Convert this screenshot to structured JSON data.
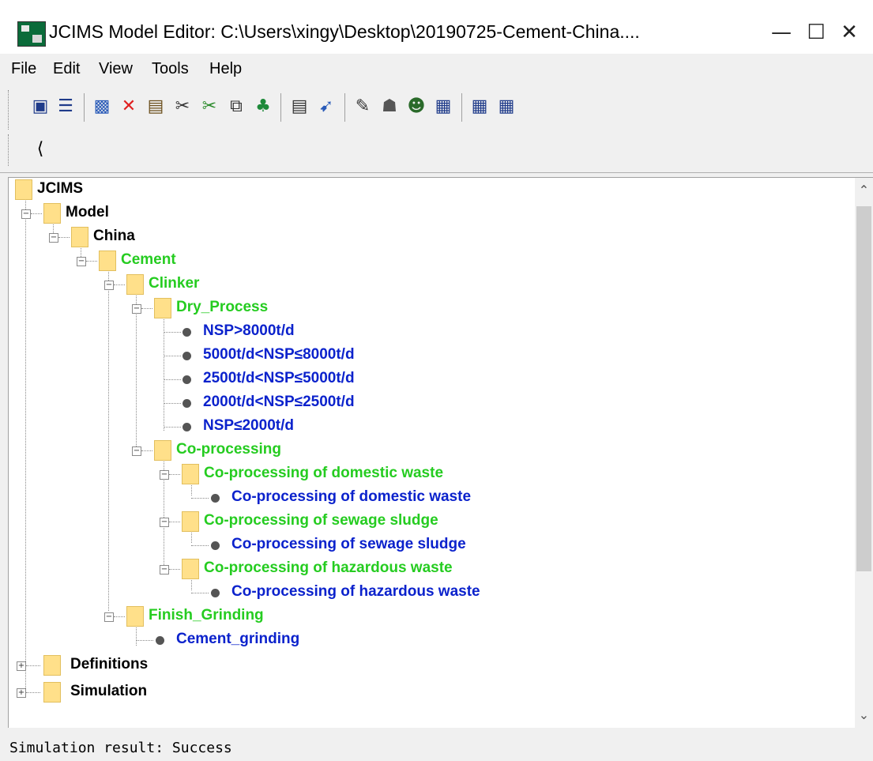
{
  "window": {
    "title": "JCIMS Model Editor:  C:\\Users\\xingy\\Desktop\\20190725-Cement-China....",
    "minimize": "—",
    "maximize": "☐",
    "close": "✕"
  },
  "menu": [
    "File",
    "Edit",
    "View",
    "Tools",
    "Help"
  ],
  "toolbar": {
    "icons": [
      "save-icon",
      "list-icon",
      "new-object-icon",
      "delete-icon",
      "paste-icon",
      "cut-icon",
      "cut-alt-icon",
      "copy-icon",
      "tree-icon",
      "properties-icon",
      "inspect-icon",
      "edit-pen-icon",
      "settings-icon",
      "users-icon",
      "edit-table-icon",
      "table-icon",
      "grid-icon",
      "connector-icon"
    ]
  },
  "tree": {
    "root": "JCIMS",
    "model": "Model",
    "china": "China",
    "cement": "Cement",
    "clinker": "Clinker",
    "dry_process": "Dry_Process",
    "dry_items": [
      "NSP>8000t/d",
      "5000t/d<NSP≤8000t/d",
      "2500t/d<NSP≤5000t/d",
      "2000t/d<NSP≤2500t/d",
      "NSP≤2000t/d"
    ],
    "coprocessing": "Co-processing",
    "cp_domestic": "Co-processing of domestic waste",
    "cp_domestic_leaf": "Co-processing of domestic waste",
    "cp_sewage": "Co-processing of sewage sludge",
    "cp_sewage_leaf": "Co-processing of sewage sludge",
    "cp_hazard": "Co-processing of hazardous waste",
    "cp_hazard_leaf": "Co-processing of hazardous waste",
    "finish_grinding": "Finish_Grinding",
    "cement_grinding": "Cement_grinding",
    "definitions": "Definitions",
    "simulation": "Simulation",
    "expanded_sign": "−",
    "collapsed_sign": "+"
  },
  "status": "Simulation result: Success",
  "colors": {
    "group": "#25cc20",
    "process": "#0b22cc",
    "folder": "#ffe08a"
  }
}
